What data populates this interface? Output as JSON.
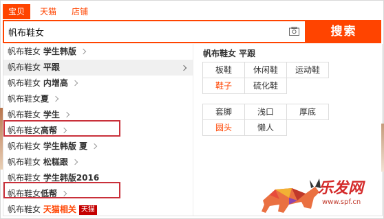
{
  "tabs": [
    {
      "label": "宝贝",
      "active": true
    },
    {
      "label": "天猫",
      "active": false
    },
    {
      "label": "店铺",
      "active": false
    }
  ],
  "search": {
    "value": "帆布鞋女",
    "button_label": "搜索"
  },
  "suggestions": [
    {
      "prefix": "帆布鞋女 ",
      "bold": "学生韩版",
      "chevron": true
    },
    {
      "prefix": "帆布鞋女 ",
      "bold": "平跟",
      "chevron": true,
      "highlighted": true
    },
    {
      "prefix": "帆布鞋女 ",
      "bold": "内增高",
      "chevron": true
    },
    {
      "prefix": "帆布鞋女",
      "bold": "夏",
      "chevron": true
    },
    {
      "prefix": "帆布鞋女 ",
      "bold": "学生",
      "chevron": true
    },
    {
      "prefix": "帆布鞋女",
      "bold": "高帮",
      "chevron": true,
      "boxed": true
    },
    {
      "prefix": "帆布鞋女 ",
      "bold": "学生韩版 夏",
      "chevron": true
    },
    {
      "prefix": "帆布鞋女 ",
      "bold": "松糕跟",
      "chevron": true
    },
    {
      "prefix": "帆布鞋女 ",
      "bold": "学生韩版2016",
      "chevron": false
    },
    {
      "prefix": "帆布鞋女",
      "bold": "低帮",
      "chevron": true,
      "boxed": true
    },
    {
      "prefix": "帆布鞋女 ",
      "bold": "天猫相关",
      "chevron": false,
      "red": true,
      "badge": "天猫"
    }
  ],
  "right_panel": {
    "title": "帆布鞋女 平跟",
    "group1": [
      {
        "label": "板鞋",
        "red": false
      },
      {
        "label": "休闲鞋",
        "red": false
      },
      {
        "label": "运动鞋",
        "red": false
      },
      {
        "label": "鞋子",
        "red": true
      },
      {
        "label": "硫化鞋",
        "red": false
      }
    ],
    "group2": [
      {
        "label": "套脚",
        "red": false
      },
      {
        "label": "浅口",
        "red": false
      },
      {
        "label": "厚底",
        "red": false
      },
      {
        "label": "圆头",
        "red": true
      },
      {
        "label": "懒人",
        "red": false
      }
    ]
  },
  "watermark": {
    "text": "乐发网",
    "url": "www.spf.cn"
  },
  "colors": {
    "accent": "#ff4400",
    "annotation_box": "#c9303a"
  }
}
